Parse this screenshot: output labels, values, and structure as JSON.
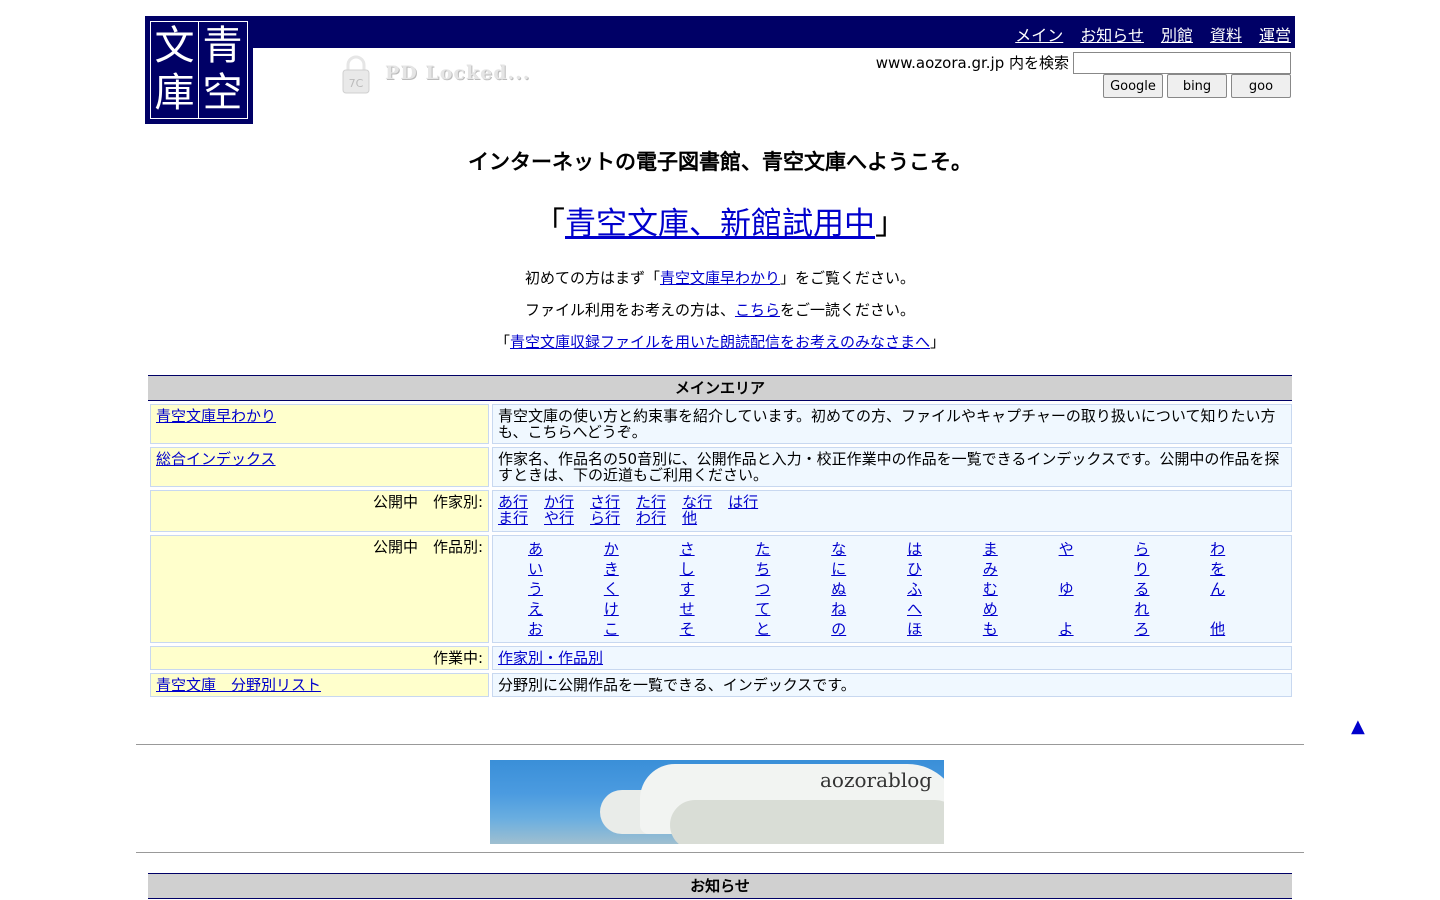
{
  "logo": {
    "chars": [
      "青",
      "文",
      "空",
      "庫"
    ]
  },
  "nav": {
    "items": [
      "メイン",
      "お知らせ",
      "別館",
      "資料",
      "運営"
    ]
  },
  "pdlock": {
    "text": "PD Locked..."
  },
  "search": {
    "label": "www.aozora.gr.jp 内を検索",
    "value": "",
    "buttons": [
      "Google",
      "bing",
      "goo"
    ]
  },
  "welcome": "インターネットの電子図書館、青空文庫へようこそ。",
  "newlib": {
    "open": "「",
    "link": "青空文庫、新館試用中",
    "close": "」"
  },
  "messages": {
    "m1_pre": "初めての方はまず「",
    "m1_link": "青空文庫早わかり",
    "m1_post": "」をご覧ください。",
    "m2_pre": "ファイル利用をお考えの方は、",
    "m2_link": "こちら",
    "m2_post": "をご一読ください。",
    "m3_pre": "「",
    "m3_link": "青空文庫収録ファイルを用いた朗読配信をお考えのみなさまへ",
    "m3_post": "」"
  },
  "main_area": {
    "header": "メインエリア",
    "rows": {
      "hayawakari": {
        "link": "青空文庫早わかり",
        "desc": "青空文庫の使い方と約束事を紹介しています。初めての方、ファイルやキャプチャーの取り扱いについて知りたい方も、こちらへどうぞ。"
      },
      "index": {
        "link": "総合インデックス",
        "desc": "作家名、作品名の50音別に、公開作品と入力・校正作業中の作品を一覧できるインデックスです。公開中の作品を探すときは、下の近道もご利用ください。"
      },
      "authors": {
        "label": "公開中　作家別:",
        "line1": [
          "あ行",
          "か行",
          "さ行",
          "た行",
          "な行",
          "は行"
        ],
        "line2": [
          "ま行",
          "や行",
          "ら行",
          "わ行",
          "他"
        ]
      },
      "works": {
        "label": "公開中　作品別:",
        "rows": [
          [
            "あ",
            "か",
            "さ",
            "た",
            "な",
            "は",
            "ま",
            "や",
            "ら",
            "わ"
          ],
          [
            "い",
            "き",
            "し",
            "ち",
            "に",
            "ひ",
            "み",
            "",
            "り",
            "を"
          ],
          [
            "う",
            "く",
            "す",
            "つ",
            "ぬ",
            "ふ",
            "む",
            "ゆ",
            "る",
            "ん"
          ],
          [
            "え",
            "け",
            "せ",
            "て",
            "ね",
            "へ",
            "め",
            "",
            "れ",
            ""
          ],
          [
            "お",
            "こ",
            "そ",
            "と",
            "の",
            "ほ",
            "も",
            "よ",
            "ろ",
            "他"
          ]
        ]
      },
      "inprogress": {
        "label": "作業中:",
        "link": "作家別・作品別"
      },
      "bunya": {
        "link": "青空文庫　分野別リスト",
        "desc": "分野別に公開作品を一覧できる、インデックスです。"
      }
    }
  },
  "top_arrow": "▲",
  "banner": {
    "text": "aozorablog"
  },
  "oshirase": {
    "header": "お知らせ"
  }
}
